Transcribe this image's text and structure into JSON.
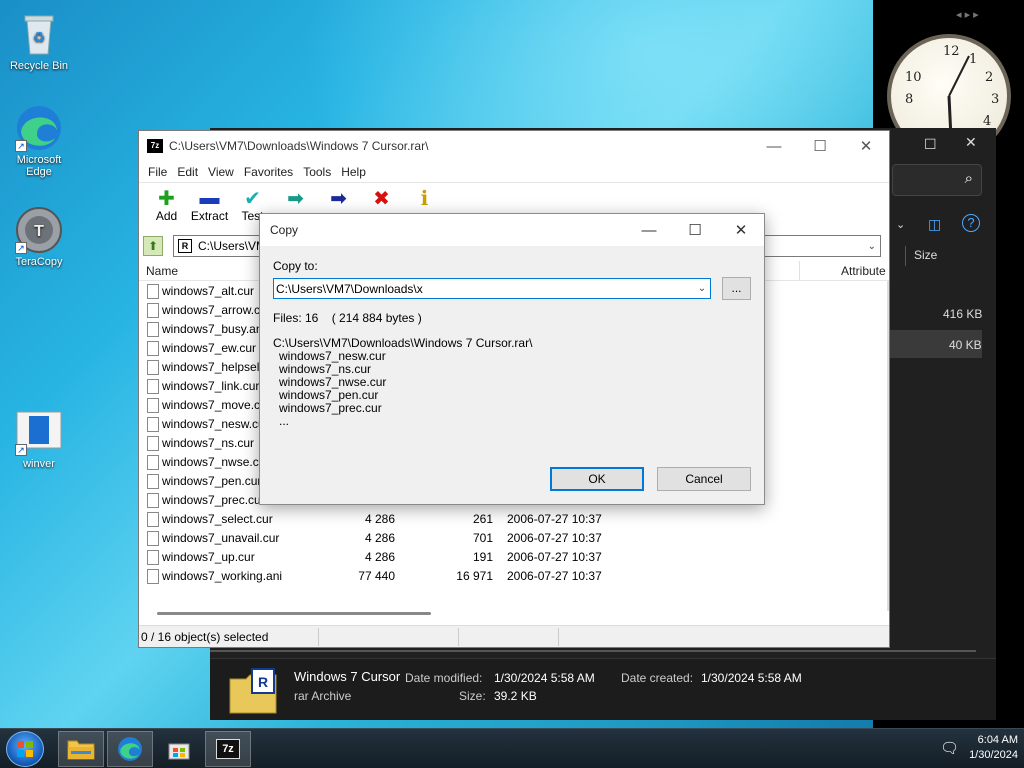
{
  "desktop": {
    "icons": [
      {
        "label": "Recycle Bin"
      },
      {
        "label": "Microsoft Edge"
      },
      {
        "label": "TeraCopy"
      },
      {
        "label": "winver"
      }
    ]
  },
  "explorer": {
    "sizes": [
      "416 KB",
      "40 KB"
    ],
    "size_header": "Size",
    "details": {
      "name": "Windows 7 Cursor",
      "type": "rar Archive",
      "date_modified_label": "Date modified:",
      "date_modified": "1/30/2024 5:58 AM",
      "size_label": "Size:",
      "size": "39.2 KB",
      "date_created_label": "Date created:",
      "date_created": "1/30/2024 5:58 AM"
    }
  },
  "zip": {
    "title": "C:\\Users\\VM7\\Downloads\\Windows 7 Cursor.rar\\",
    "icon_text": "7z",
    "menu": [
      "File",
      "Edit",
      "View",
      "Favorites",
      "Tools",
      "Help"
    ],
    "toolbar": [
      {
        "label": "Add",
        "icon": "plus-icon",
        "glyph": "✚",
        "color": "#1aa31a"
      },
      {
        "label": "Extract",
        "icon": "minus-icon",
        "glyph": "▬",
        "color": "#1a3cb8"
      },
      {
        "label": "Test",
        "icon": "check-icon",
        "glyph": "✔",
        "color": "#1ab0b0"
      },
      {
        "label": "",
        "icon": "copy-arrow-icon",
        "glyph": "➡",
        "color": "#1a9a8a"
      },
      {
        "label": "",
        "icon": "move-arrow-icon",
        "glyph": "➡",
        "color": "#1a2a9a"
      },
      {
        "label": "",
        "icon": "delete-icon",
        "glyph": "✖",
        "color": "#d81010"
      },
      {
        "label": "",
        "icon": "info-icon",
        "glyph": "ℹ",
        "color": "#c8a000"
      }
    ],
    "address": "C:\\Users\\VM",
    "columns": {
      "name": "Name",
      "attributes": "Attribute"
    },
    "files": [
      {
        "name": "windows7_alt.cur",
        "size": "",
        "packed": "",
        "modified": ""
      },
      {
        "name": "windows7_arrow.c",
        "size": "",
        "packed": "",
        "modified": ""
      },
      {
        "name": "windows7_busy.an",
        "size": "",
        "packed": "",
        "modified": ""
      },
      {
        "name": "windows7_ew.cur",
        "size": "",
        "packed": "",
        "modified": ""
      },
      {
        "name": "windows7_helpsel.",
        "size": "",
        "packed": "",
        "modified": ""
      },
      {
        "name": "windows7_link.cur",
        "size": "",
        "packed": "",
        "modified": ""
      },
      {
        "name": "windows7_move.c",
        "size": "",
        "packed": "",
        "modified": ""
      },
      {
        "name": "windows7_nesw.cu",
        "size": "",
        "packed": "",
        "modified": ""
      },
      {
        "name": "windows7_ns.cur",
        "size": "",
        "packed": "",
        "modified": ""
      },
      {
        "name": "windows7_nwse.cu",
        "size": "",
        "packed": "",
        "modified": ""
      },
      {
        "name": "windows7_pen.cur",
        "size": "",
        "packed": "",
        "modified": ""
      },
      {
        "name": "windows7_prec.cu",
        "size": "",
        "packed": "",
        "modified": ""
      },
      {
        "name": "windows7_select.cur",
        "size": "4 286",
        "packed": "261",
        "modified": "2006-07-27 10:37"
      },
      {
        "name": "windows7_unavail.cur",
        "size": "4 286",
        "packed": "701",
        "modified": "2006-07-27 10:37"
      },
      {
        "name": "windows7_up.cur",
        "size": "4 286",
        "packed": "191",
        "modified": "2006-07-27 10:37"
      },
      {
        "name": "windows7_working.ani",
        "size": "77 440",
        "packed": "16 971",
        "modified": "2006-07-27 10:37"
      }
    ],
    "status": "0 / 16 object(s) selected"
  },
  "dialog": {
    "title": "Copy",
    "copy_to_label": "Copy to:",
    "copy_to_value": "C:\\Users\\VM7\\Downloads\\x",
    "browse_label": "...",
    "files_info": "Files: 16    ( 214 884 bytes )",
    "source_path": "C:\\Users\\VM7\\Downloads\\Windows 7 Cursor.rar\\",
    "file_list": [
      "windows7_nesw.cur",
      "windows7_ns.cur",
      "windows7_nwse.cur",
      "windows7_pen.cur",
      "windows7_prec.cur",
      "..."
    ],
    "ok_label": "OK",
    "cancel_label": "Cancel"
  },
  "taskbar": {
    "time": "6:04 AM",
    "date": "1/30/2024",
    "seven_zip_label": "7z"
  }
}
